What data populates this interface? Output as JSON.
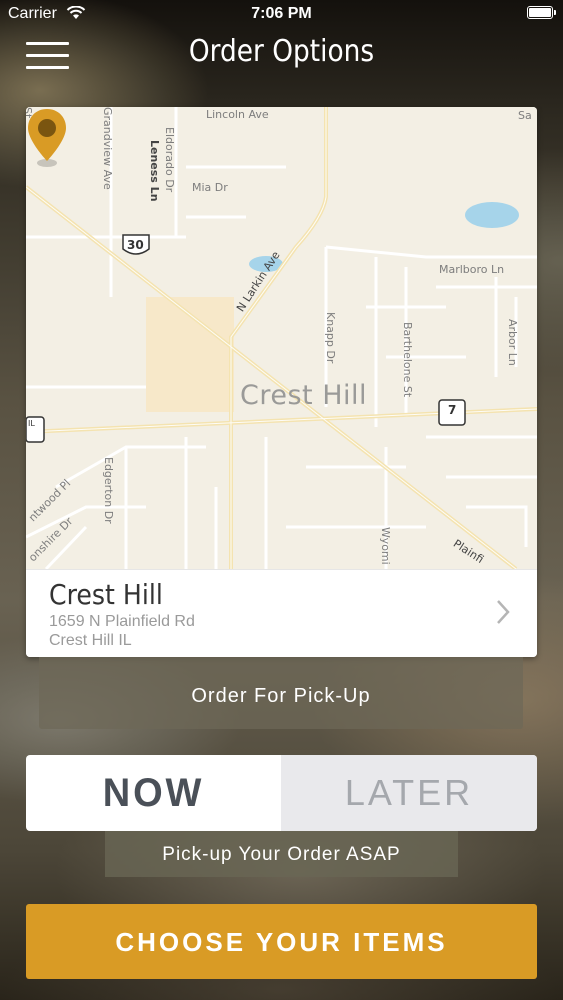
{
  "status_bar": {
    "carrier": "Carrier",
    "time": "7:06 PM"
  },
  "nav": {
    "title": "Order Options",
    "menu_icon": "hamburger-menu-icon"
  },
  "map": {
    "city": "Crest Hill",
    "streets": {
      "lincoln": "Lincoln Ave",
      "eldorado": "Eldorado Dr",
      "leness": "Leness Ln",
      "mia": "Mia Dr",
      "larkin": "N Larkin Ave",
      "knapp": "Knapp Dr",
      "barthelone": "Barthelone St",
      "arbor": "Arbor Ln",
      "marlboro": "Marlboro Ln",
      "edgerton": "Edgerton Dr",
      "wyoming": "Wyomi",
      "plainfield": "Plainfi",
      "grandview": "Grandview Ave",
      "st": "St",
      "sa": "Sa",
      "brentwood": "ntwood Pl",
      "devonshire": "onshire Dr"
    },
    "route_30": "30",
    "route_7": "7",
    "route_il": "IL",
    "pin_color": "#d99b25",
    "water_color": "#a6d4ea"
  },
  "location": {
    "name": "Crest Hill",
    "address_line1": "1659 N Plainfield Rd",
    "address_line2": "Crest Hill IL"
  },
  "order_type": {
    "label": "Order For Pick-Up"
  },
  "timing": {
    "now": "NOW",
    "later": "LATER",
    "selected": "NOW",
    "note": "Pick-up Your Order ASAP"
  },
  "cta": {
    "label": "CHOOSE YOUR ITEMS",
    "color": "#d99b25"
  }
}
